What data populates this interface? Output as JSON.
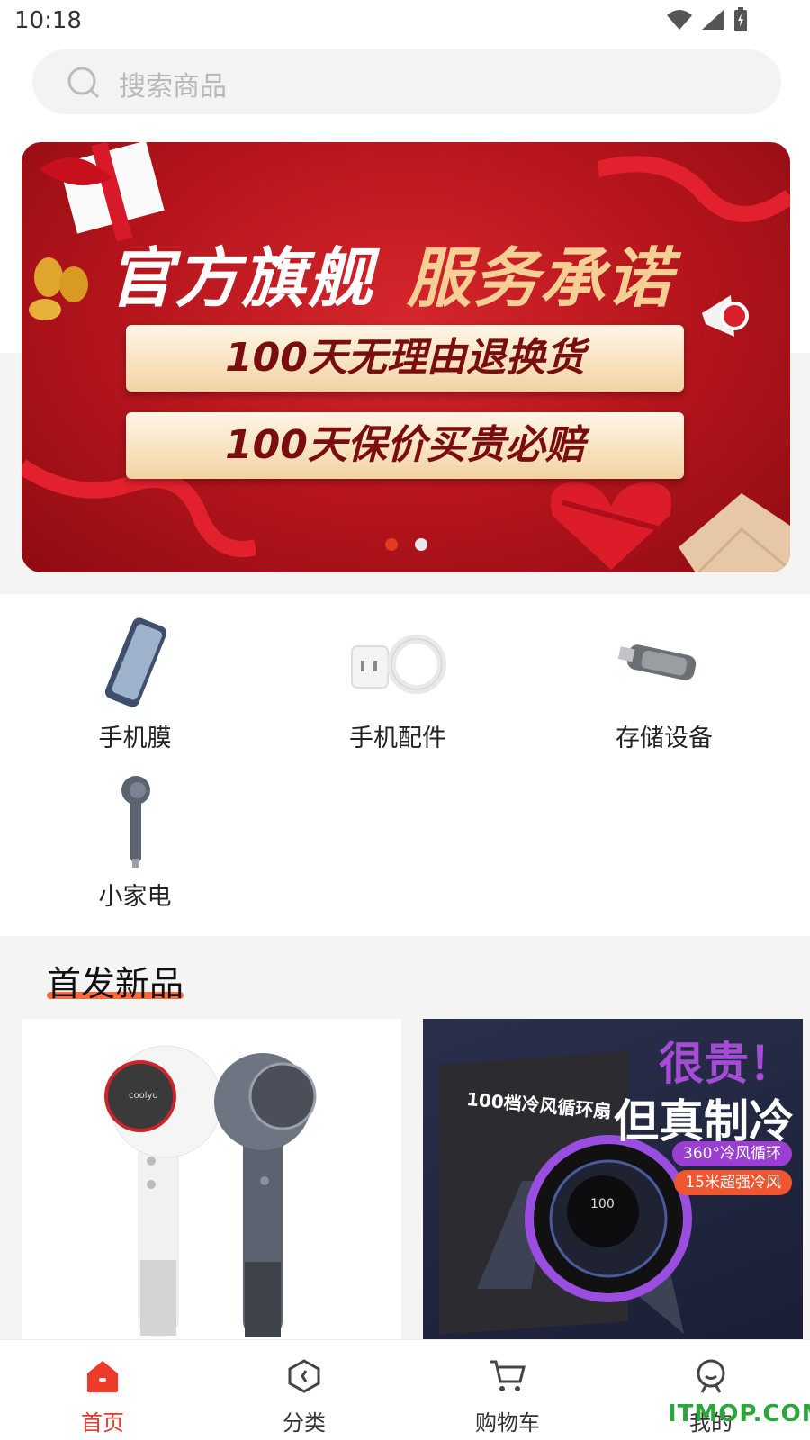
{
  "status_bar": {
    "time": "10:18"
  },
  "search": {
    "placeholder": "搜索商品"
  },
  "banner": {
    "title_left": "官方旗舰",
    "title_right": "服务承诺",
    "line1": "100天无理由退换货",
    "line2": "100天保价买贵必赔",
    "slide_count": 2,
    "active_slide": 1
  },
  "categories": [
    {
      "label": "手机膜",
      "icon": "phone-film-icon"
    },
    {
      "label": "手机配件",
      "icon": "charger-icon"
    },
    {
      "label": "存储设备",
      "icon": "usb-drive-icon"
    },
    {
      "label": "小家电",
      "icon": "hair-dryer-icon"
    }
  ],
  "section": {
    "title": "首发新品"
  },
  "products": {
    "p1": {
      "brand": "coolyu"
    },
    "p2": {
      "headline1": "很贵！",
      "headline2": "但真制冷",
      "tag": "100档冷风循环扇",
      "pill1": "360°冷风循环",
      "pill2": "15米超强冷风"
    }
  },
  "tabbar": {
    "tabs": [
      {
        "label": "首页",
        "icon": "home-icon",
        "active": true
      },
      {
        "label": "分类",
        "icon": "category-icon",
        "active": false
      },
      {
        "label": "购物车",
        "icon": "cart-icon",
        "active": false
      },
      {
        "label": "我的",
        "icon": "profile-icon",
        "active": false
      }
    ]
  },
  "watermark": "ITMOP.COM",
  "colors": {
    "accent": "#e8382b",
    "banner_red": "#c41a22",
    "gold": "#f6cf94",
    "underline": "#ff6a3d"
  }
}
